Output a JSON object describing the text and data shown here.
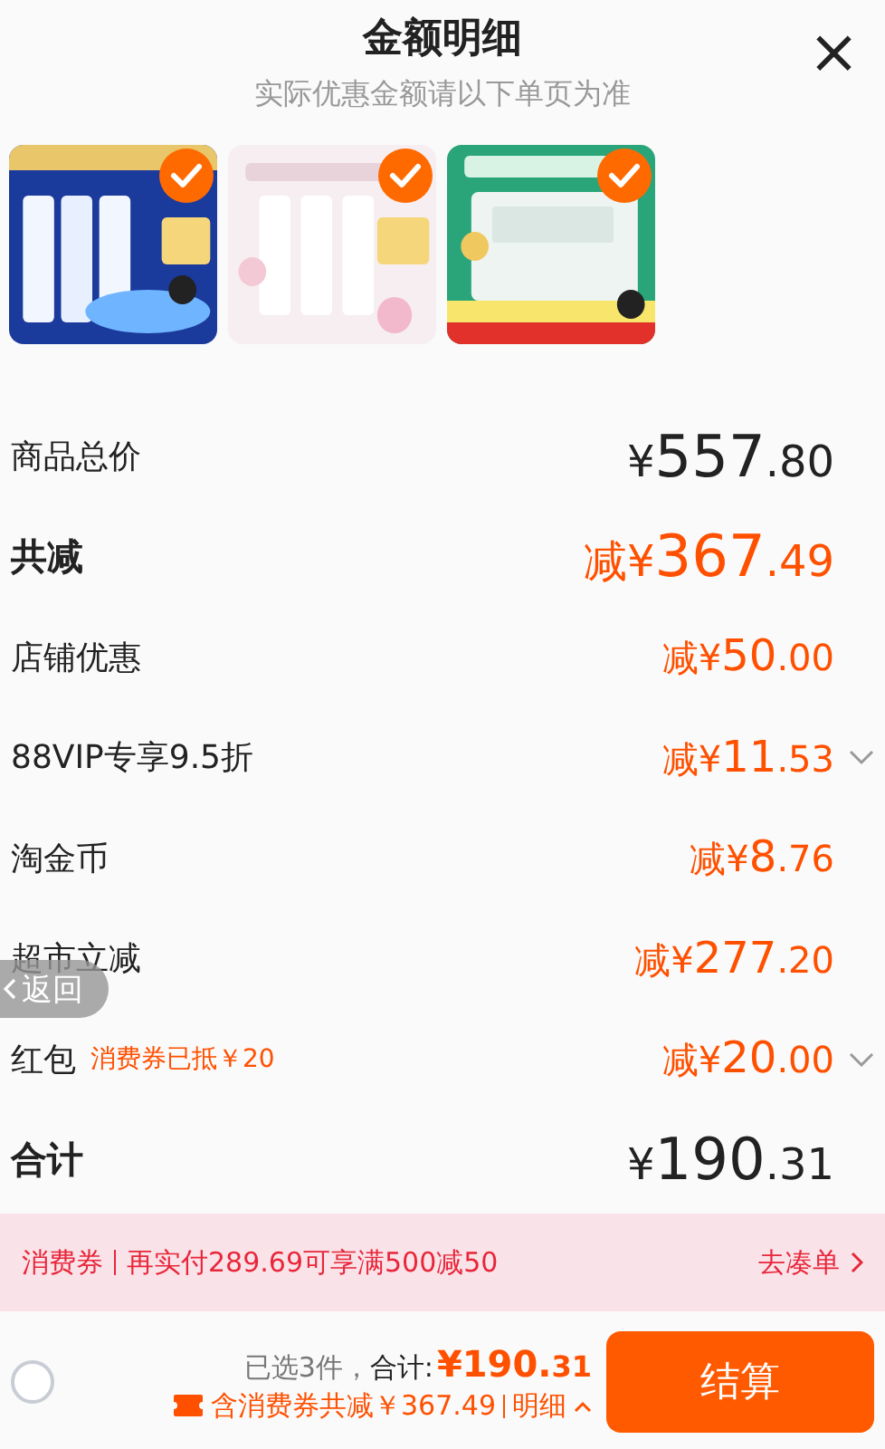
{
  "header": {
    "title": "金额明细",
    "subtitle": "实际优惠金额请以下单页为准",
    "close": "×"
  },
  "products": [
    {
      "kind": "picture",
      "checked": true
    },
    {
      "kind": "picture",
      "checked": true
    },
    {
      "kind": "picture",
      "checked": true
    }
  ],
  "rows": [
    {
      "kind": "total",
      "label": "商品总价",
      "prefix": "¥",
      "integer": "557",
      "decimal": ".80",
      "expandable": false
    },
    {
      "kind": "saving",
      "label": "共减",
      "prefix": "减¥",
      "integer": "367",
      "decimal": ".49",
      "expandable": false
    },
    {
      "kind": "discount",
      "label": "店铺优惠",
      "prefix": "减¥",
      "integer": "50",
      "decimal": ".00",
      "expandable": false
    },
    {
      "kind": "discount",
      "label": "88VIP专享9.5折",
      "prefix": "减¥",
      "integer": "11",
      "decimal": ".53",
      "expandable": true
    },
    {
      "kind": "discount",
      "label": "淘金币",
      "prefix": "减¥",
      "integer": "8",
      "decimal": ".76",
      "expandable": false
    },
    {
      "kind": "discount",
      "label": "超市立减",
      "prefix": "减¥",
      "integer": "277",
      "decimal": ".20",
      "expandable": false
    },
    {
      "kind": "discount",
      "label": "红包",
      "note": "消费券已抵￥20",
      "prefix": "减¥",
      "integer": "20",
      "decimal": ".00",
      "expandable": true
    },
    {
      "kind": "total",
      "label": "合计",
      "prefix": "¥",
      "integer": "190",
      "decimal": ".31",
      "expandable": false
    }
  ],
  "back_button": {
    "label": "返回"
  },
  "coupon_banner": {
    "tag": "消费券",
    "message": "再实付289.69可享满500减50",
    "action": "去凑单"
  },
  "footer": {
    "select_all": {
      "checked": false
    },
    "count": "已选3件，",
    "total_label": "合计:",
    "total": "¥190.",
    "total_decimal": "31",
    "savings": "含消费券共减￥367.49",
    "details": "明细",
    "checkout": "结算"
  }
}
